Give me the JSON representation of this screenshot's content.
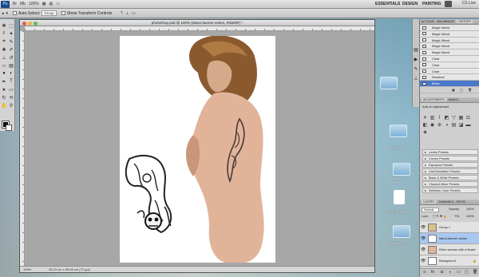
{
  "app": {
    "logo": "Ps",
    "zoom": "100%",
    "workspaces": [
      "ESSENTIALS",
      "DESIGN",
      "PAINTING"
    ],
    "cs_live": "CS Live"
  },
  "options_bar": {
    "new_selection_label": "Auto-Select:",
    "group_value": "Group",
    "transform_label": "Show Transform Controls"
  },
  "document": {
    "title": "photoshop.psd @ 100% (tattoo-banner-varies, RGB/8#) *",
    "zoom": "100%",
    "doc_info": "28.23 cm x 38.08 cm (72 ppi)"
  },
  "history": {
    "tabs": [
      "ACTIONS",
      "MINI BRIDGE",
      "HISTORY"
    ],
    "rows": [
      {
        "label": "Magic Wand",
        "selected": false
      },
      {
        "label": "Magic Wand",
        "selected": false
      },
      {
        "label": "Magic Wand",
        "selected": false
      },
      {
        "label": "Magic Wand",
        "selected": false
      },
      {
        "label": "Magic Wand",
        "selected": false
      },
      {
        "label": "Clear",
        "selected": false
      },
      {
        "label": "Clear",
        "selected": false
      },
      {
        "label": "Clear",
        "selected": false
      },
      {
        "label": "Deselect",
        "selected": false
      },
      {
        "label": "Move",
        "selected": true
      }
    ]
  },
  "adjustments": {
    "tabs": [
      "ADJUSTMENTS",
      "MASKS"
    ],
    "heading": "Add an adjustment",
    "presets": [
      "Levels Presets",
      "Curves Presets",
      "Exposure Presets",
      "Hue/Saturation Presets",
      "Black & White Presets",
      "Channel Mixer Presets",
      "Selective Color Presets"
    ]
  },
  "layers": {
    "tabs": [
      "LAYERS",
      "CHANNELS",
      "PATHS"
    ],
    "blend_mode": "Normal",
    "opacity_label": "Opacity:",
    "opacity_value": "100%",
    "lock_label": "Lock:",
    "fill_label": "Fill:",
    "fill_value": "100%",
    "rows": [
      {
        "name": "Group 1",
        "selected": false
      },
      {
        "name": "tattoo-banner-varies",
        "selected": true
      },
      {
        "name": "Retro woman with a flower",
        "selected": false
      },
      {
        "name": "Background",
        "selected": false
      }
    ]
  },
  "desktop": {
    "labels": [
      "blue skin",
      "Untitled",
      "Kelly Dirt 2 dino...",
      "Untitled",
      "Clamshell 18"
    ]
  }
}
